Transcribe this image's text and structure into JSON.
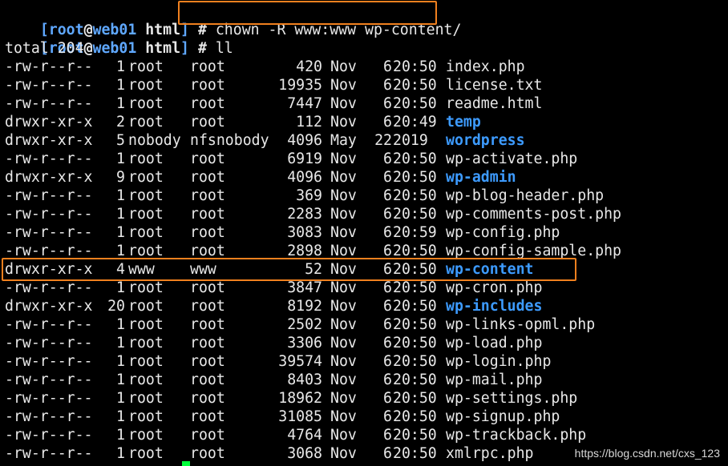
{
  "prompt": {
    "open_bracket": "[",
    "user": "root",
    "at": "@",
    "host": "web01",
    "dir": "html",
    "close_bracket": "]",
    "hash": "#"
  },
  "commands": [
    "chown -R www:www wp-content/",
    "ll"
  ],
  "total_line": "total 204",
  "listing": [
    {
      "perm": "-rw-r--r--",
      "links": "1",
      "owner": "root",
      "group": "root",
      "size": "420",
      "month": "Nov",
      "day": "6",
      "time": "20:50",
      "name": "index.php",
      "is_dir": false
    },
    {
      "perm": "-rw-r--r--",
      "links": "1",
      "owner": "root",
      "group": "root",
      "size": "19935",
      "month": "Nov",
      "day": "6",
      "time": "20:50",
      "name": "license.txt",
      "is_dir": false
    },
    {
      "perm": "-rw-r--r--",
      "links": "1",
      "owner": "root",
      "group": "root",
      "size": "7447",
      "month": "Nov",
      "day": "6",
      "time": "20:50",
      "name": "readme.html",
      "is_dir": false
    },
    {
      "perm": "drwxr-xr-x",
      "links": "2",
      "owner": "root",
      "group": "root",
      "size": "112",
      "month": "Nov",
      "day": "6",
      "time": "20:49",
      "name": "temp",
      "is_dir": true
    },
    {
      "perm": "drwxr-xr-x",
      "links": "5",
      "owner": "nobody",
      "group": "nfsnobody",
      "size": "4096",
      "month": "May",
      "day": "22",
      "time": "2019",
      "name": "wordpress",
      "is_dir": true
    },
    {
      "perm": "-rw-r--r--",
      "links": "1",
      "owner": "root",
      "group": "root",
      "size": "6919",
      "month": "Nov",
      "day": "6",
      "time": "20:50",
      "name": "wp-activate.php",
      "is_dir": false
    },
    {
      "perm": "drwxr-xr-x",
      "links": "9",
      "owner": "root",
      "group": "root",
      "size": "4096",
      "month": "Nov",
      "day": "6",
      "time": "20:50",
      "name": "wp-admin",
      "is_dir": true
    },
    {
      "perm": "-rw-r--r--",
      "links": "1",
      "owner": "root",
      "group": "root",
      "size": "369",
      "month": "Nov",
      "day": "6",
      "time": "20:50",
      "name": "wp-blog-header.php",
      "is_dir": false
    },
    {
      "perm": "-rw-r--r--",
      "links": "1",
      "owner": "root",
      "group": "root",
      "size": "2283",
      "month": "Nov",
      "day": "6",
      "time": "20:50",
      "name": "wp-comments-post.php",
      "is_dir": false
    },
    {
      "perm": "-rw-r--r--",
      "links": "1",
      "owner": "root",
      "group": "root",
      "size": "3083",
      "month": "Nov",
      "day": "6",
      "time": "20:59",
      "name": "wp-config.php",
      "is_dir": false
    },
    {
      "perm": "-rw-r--r--",
      "links": "1",
      "owner": "root",
      "group": "root",
      "size": "2898",
      "month": "Nov",
      "day": "6",
      "time": "20:50",
      "name": "wp-config-sample.php",
      "is_dir": false
    },
    {
      "perm": "drwxr-xr-x",
      "links": "4",
      "owner": "www",
      "group": "www",
      "size": "52",
      "month": "Nov",
      "day": "6",
      "time": "20:50",
      "name": "wp-content",
      "is_dir": true
    },
    {
      "perm": "-rw-r--r--",
      "links": "1",
      "owner": "root",
      "group": "root",
      "size": "3847",
      "month": "Nov",
      "day": "6",
      "time": "20:50",
      "name": "wp-cron.php",
      "is_dir": false
    },
    {
      "perm": "drwxr-xr-x",
      "links": "20",
      "owner": "root",
      "group": "root",
      "size": "8192",
      "month": "Nov",
      "day": "6",
      "time": "20:50",
      "name": "wp-includes",
      "is_dir": true
    },
    {
      "perm": "-rw-r--r--",
      "links": "1",
      "owner": "root",
      "group": "root",
      "size": "2502",
      "month": "Nov",
      "day": "6",
      "time": "20:50",
      "name": "wp-links-opml.php",
      "is_dir": false
    },
    {
      "perm": "-rw-r--r--",
      "links": "1",
      "owner": "root",
      "group": "root",
      "size": "3306",
      "month": "Nov",
      "day": "6",
      "time": "20:50",
      "name": "wp-load.php",
      "is_dir": false
    },
    {
      "perm": "-rw-r--r--",
      "links": "1",
      "owner": "root",
      "group": "root",
      "size": "39574",
      "month": "Nov",
      "day": "6",
      "time": "20:50",
      "name": "wp-login.php",
      "is_dir": false
    },
    {
      "perm": "-rw-r--r--",
      "links": "1",
      "owner": "root",
      "group": "root",
      "size": "8403",
      "month": "Nov",
      "day": "6",
      "time": "20:50",
      "name": "wp-mail.php",
      "is_dir": false
    },
    {
      "perm": "-rw-r--r--",
      "links": "1",
      "owner": "root",
      "group": "root",
      "size": "18962",
      "month": "Nov",
      "day": "6",
      "time": "20:50",
      "name": "wp-settings.php",
      "is_dir": false
    },
    {
      "perm": "-rw-r--r--",
      "links": "1",
      "owner": "root",
      "group": "root",
      "size": "31085",
      "month": "Nov",
      "day": "6",
      "time": "20:50",
      "name": "wp-signup.php",
      "is_dir": false
    },
    {
      "perm": "-rw-r--r--",
      "links": "1",
      "owner": "root",
      "group": "root",
      "size": "4764",
      "month": "Nov",
      "day": "6",
      "time": "20:50",
      "name": "wp-trackback.php",
      "is_dir": false
    },
    {
      "perm": "-rw-r--r--",
      "links": "1",
      "owner": "root",
      "group": "root",
      "size": "3068",
      "month": "Nov",
      "day": "6",
      "time": "20:50",
      "name": "xmlrpc.php",
      "is_dir": false
    }
  ],
  "watermark": "https://blog.csdn.net/cxs_123",
  "colors": {
    "background": "#000000",
    "text": "#e8e8e8",
    "prompt": "#5fa8ff",
    "directory": "#3d9bff",
    "highlight": "#f0801e",
    "cursor": "#00ff3a"
  }
}
